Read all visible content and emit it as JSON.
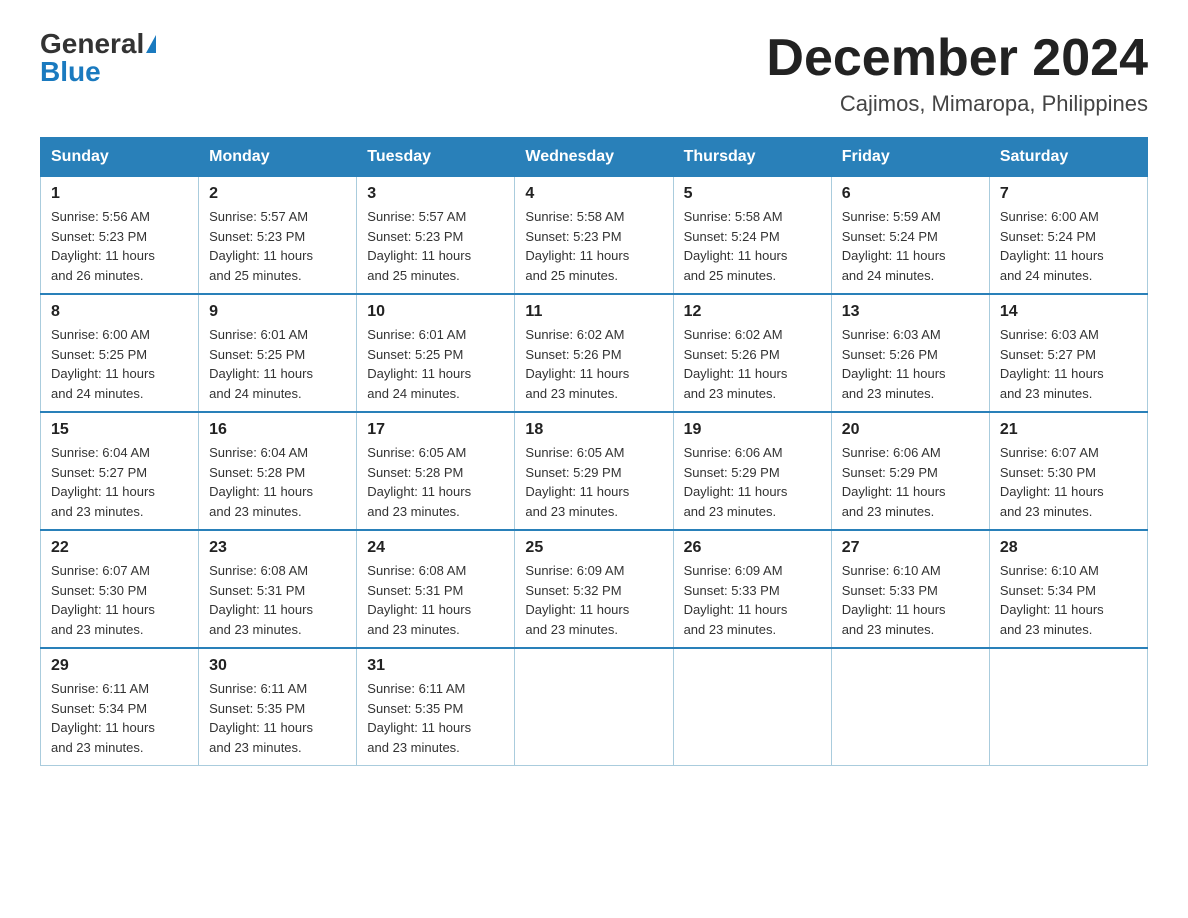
{
  "header": {
    "logo_general": "General",
    "logo_blue": "Blue",
    "month_title": "December 2024",
    "location": "Cajimos, Mimaropa, Philippines"
  },
  "days_of_week": [
    "Sunday",
    "Monday",
    "Tuesday",
    "Wednesday",
    "Thursday",
    "Friday",
    "Saturday"
  ],
  "weeks": [
    [
      {
        "num": "1",
        "sunrise": "5:56 AM",
        "sunset": "5:23 PM",
        "daylight": "11 hours and 26 minutes."
      },
      {
        "num": "2",
        "sunrise": "5:57 AM",
        "sunset": "5:23 PM",
        "daylight": "11 hours and 25 minutes."
      },
      {
        "num": "3",
        "sunrise": "5:57 AM",
        "sunset": "5:23 PM",
        "daylight": "11 hours and 25 minutes."
      },
      {
        "num": "4",
        "sunrise": "5:58 AM",
        "sunset": "5:23 PM",
        "daylight": "11 hours and 25 minutes."
      },
      {
        "num": "5",
        "sunrise": "5:58 AM",
        "sunset": "5:24 PM",
        "daylight": "11 hours and 25 minutes."
      },
      {
        "num": "6",
        "sunrise": "5:59 AM",
        "sunset": "5:24 PM",
        "daylight": "11 hours and 24 minutes."
      },
      {
        "num": "7",
        "sunrise": "6:00 AM",
        "sunset": "5:24 PM",
        "daylight": "11 hours and 24 minutes."
      }
    ],
    [
      {
        "num": "8",
        "sunrise": "6:00 AM",
        "sunset": "5:25 PM",
        "daylight": "11 hours and 24 minutes."
      },
      {
        "num": "9",
        "sunrise": "6:01 AM",
        "sunset": "5:25 PM",
        "daylight": "11 hours and 24 minutes."
      },
      {
        "num": "10",
        "sunrise": "6:01 AM",
        "sunset": "5:25 PM",
        "daylight": "11 hours and 24 minutes."
      },
      {
        "num": "11",
        "sunrise": "6:02 AM",
        "sunset": "5:26 PM",
        "daylight": "11 hours and 23 minutes."
      },
      {
        "num": "12",
        "sunrise": "6:02 AM",
        "sunset": "5:26 PM",
        "daylight": "11 hours and 23 minutes."
      },
      {
        "num": "13",
        "sunrise": "6:03 AM",
        "sunset": "5:26 PM",
        "daylight": "11 hours and 23 minutes."
      },
      {
        "num": "14",
        "sunrise": "6:03 AM",
        "sunset": "5:27 PM",
        "daylight": "11 hours and 23 minutes."
      }
    ],
    [
      {
        "num": "15",
        "sunrise": "6:04 AM",
        "sunset": "5:27 PM",
        "daylight": "11 hours and 23 minutes."
      },
      {
        "num": "16",
        "sunrise": "6:04 AM",
        "sunset": "5:28 PM",
        "daylight": "11 hours and 23 minutes."
      },
      {
        "num": "17",
        "sunrise": "6:05 AM",
        "sunset": "5:28 PM",
        "daylight": "11 hours and 23 minutes."
      },
      {
        "num": "18",
        "sunrise": "6:05 AM",
        "sunset": "5:29 PM",
        "daylight": "11 hours and 23 minutes."
      },
      {
        "num": "19",
        "sunrise": "6:06 AM",
        "sunset": "5:29 PM",
        "daylight": "11 hours and 23 minutes."
      },
      {
        "num": "20",
        "sunrise": "6:06 AM",
        "sunset": "5:29 PM",
        "daylight": "11 hours and 23 minutes."
      },
      {
        "num": "21",
        "sunrise": "6:07 AM",
        "sunset": "5:30 PM",
        "daylight": "11 hours and 23 minutes."
      }
    ],
    [
      {
        "num": "22",
        "sunrise": "6:07 AM",
        "sunset": "5:30 PM",
        "daylight": "11 hours and 23 minutes."
      },
      {
        "num": "23",
        "sunrise": "6:08 AM",
        "sunset": "5:31 PM",
        "daylight": "11 hours and 23 minutes."
      },
      {
        "num": "24",
        "sunrise": "6:08 AM",
        "sunset": "5:31 PM",
        "daylight": "11 hours and 23 minutes."
      },
      {
        "num": "25",
        "sunrise": "6:09 AM",
        "sunset": "5:32 PM",
        "daylight": "11 hours and 23 minutes."
      },
      {
        "num": "26",
        "sunrise": "6:09 AM",
        "sunset": "5:33 PM",
        "daylight": "11 hours and 23 minutes."
      },
      {
        "num": "27",
        "sunrise": "6:10 AM",
        "sunset": "5:33 PM",
        "daylight": "11 hours and 23 minutes."
      },
      {
        "num": "28",
        "sunrise": "6:10 AM",
        "sunset": "5:34 PM",
        "daylight": "11 hours and 23 minutes."
      }
    ],
    [
      {
        "num": "29",
        "sunrise": "6:11 AM",
        "sunset": "5:34 PM",
        "daylight": "11 hours and 23 minutes."
      },
      {
        "num": "30",
        "sunrise": "6:11 AM",
        "sunset": "5:35 PM",
        "daylight": "11 hours and 23 minutes."
      },
      {
        "num": "31",
        "sunrise": "6:11 AM",
        "sunset": "5:35 PM",
        "daylight": "11 hours and 23 minutes."
      },
      null,
      null,
      null,
      null
    ]
  ],
  "labels": {
    "sunrise": "Sunrise:",
    "sunset": "Sunset:",
    "daylight": "Daylight:"
  }
}
